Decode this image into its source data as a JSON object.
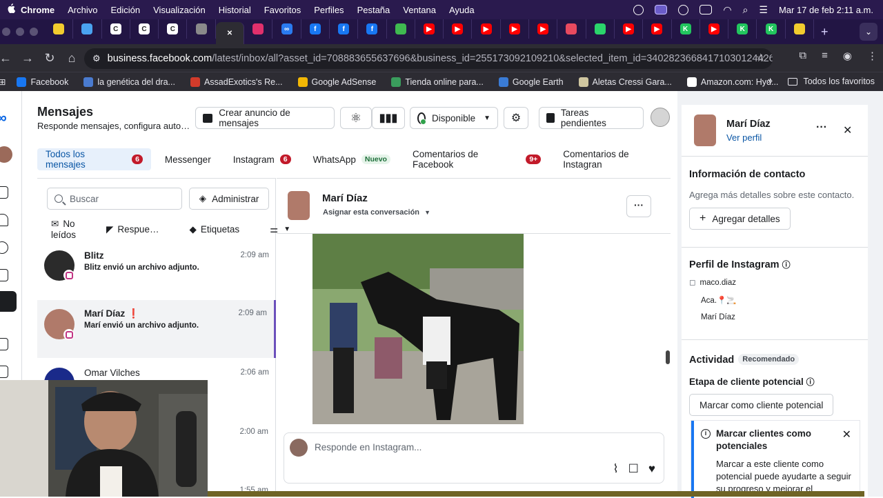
{
  "macos": {
    "menu": [
      "Chrome",
      "Archivo",
      "Edición",
      "Visualización",
      "Historial",
      "Favoritos",
      "Perfiles",
      "Pestaña",
      "Ventana",
      "Ayuda"
    ],
    "clock": "Mar 17 de feb  2:11 a.m."
  },
  "browser": {
    "url_host": "business.facebook.com",
    "url_path": "/latest/inbox/all?asset_id=708883655637696&business_id=255173092109210&selected_item_id=34028236684171030124426…",
    "tabs": [
      {
        "color": "#f2cc2e",
        "glyph": ""
      },
      {
        "color": "#4aa3f0",
        "glyph": ""
      },
      {
        "color": "#ffffff",
        "glyph": "C"
      },
      {
        "color": "#ffffff",
        "glyph": "C"
      },
      {
        "color": "#ffffff",
        "glyph": "C"
      },
      {
        "color": "#8a8a8a",
        "glyph": ""
      },
      {
        "color": "#ffffff",
        "glyph": "✕"
      },
      {
        "color": "#e1306c",
        "glyph": ""
      },
      {
        "color": "#2a7bf0",
        "glyph": "∞"
      },
      {
        "color": "#1877f2",
        "glyph": "f"
      },
      {
        "color": "#1877f2",
        "glyph": "f"
      },
      {
        "color": "#1877f2",
        "glyph": "f"
      },
      {
        "color": "#3fb950",
        "glyph": ""
      },
      {
        "color": "#ff0000",
        "glyph": "▶"
      },
      {
        "color": "#ff0000",
        "glyph": "▶"
      },
      {
        "color": "#ff0000",
        "glyph": "▶"
      },
      {
        "color": "#ff0000",
        "glyph": "▶"
      },
      {
        "color": "#ff0000",
        "glyph": "▶"
      },
      {
        "color": "#e84a5f",
        "glyph": ""
      },
      {
        "color": "#2bd46b",
        "glyph": ""
      },
      {
        "color": "#ff0000",
        "glyph": "▶"
      },
      {
        "color": "#ff0000",
        "glyph": "▶"
      },
      {
        "color": "#22c55e",
        "glyph": "K"
      },
      {
        "color": "#ff0000",
        "glyph": "▶"
      },
      {
        "color": "#22c55e",
        "glyph": "K"
      },
      {
        "color": "#22c55e",
        "glyph": "K"
      },
      {
        "color": "#f2cc2e",
        "glyph": ""
      }
    ],
    "bookmarks": [
      {
        "label": "Facebook",
        "color": "#1877f2"
      },
      {
        "label": "la genética del dra...",
        "color": "#4a7bd0"
      },
      {
        "label": "AssadExotics's Re...",
        "color": "#d23b2b"
      },
      {
        "label": "Google AdSense",
        "color": "#f2b705"
      },
      {
        "label": "Tienda online para...",
        "color": "#3a9d5d"
      },
      {
        "label": "Google Earth",
        "color": "#3a7bd5"
      },
      {
        "label": "Aletas Cressi Gara...",
        "color": "#cfc6a0"
      },
      {
        "label": "Amazon.com: Hyd...",
        "color": "#ffffff"
      }
    ],
    "all_bookmarks": "Todos los favoritos"
  },
  "inbox": {
    "title": "Mensajes",
    "subtitle": "Responde mensajes, configura auto…",
    "toolbar": {
      "create_ad": "Crear anuncio de mensajes",
      "status": "Disponible",
      "tasks": "Tareas pendientes"
    },
    "tabs": [
      {
        "label": "Todos los mensajes",
        "badge": "6"
      },
      {
        "label": "Messenger",
        "badge": ""
      },
      {
        "label": "Instagram",
        "badge": "6"
      },
      {
        "label": "WhatsApp",
        "badge": "Nuevo"
      },
      {
        "label": "Comentarios de Facebook",
        "badge": "9+"
      },
      {
        "label": "Comentarios de Instagran",
        "badge": ""
      }
    ],
    "search_placeholder": "Buscar",
    "manage_label": "Administrar",
    "filters": [
      "No leídos",
      "Respue…",
      "Etiquetas"
    ],
    "conversations": [
      {
        "name": "Blitz",
        "preview": "Blitz envió un archivo adjunto.",
        "time": "2:09 am"
      },
      {
        "name": "Marí Díaz",
        "flag": "❗",
        "preview": "Marí envió un archivo adjunto.",
        "time": "2:09 am"
      },
      {
        "name": "Omar Vilches",
        "preview": "",
        "time": "2:06 am"
      }
    ],
    "extra_times": [
      "2:00 am",
      "1:55 am"
    ],
    "chat": {
      "name": "Marí Díaz",
      "assign": "Asignar esta conversación",
      "compose_placeholder": "Responde en Instagram..."
    }
  },
  "contact": {
    "name": "Marí Díaz",
    "profile_link": "Ver perfil",
    "contact_info_title": "Información de contacto",
    "contact_info_text": "Agrega más detalles sobre este contacto.",
    "add_details": "Agregar detalles",
    "ig_title": "Perfil de Instagram",
    "ig_handle": "maco.diaz",
    "ig_bio": "Aca.📍🚬",
    "ig_name": "Marí Díaz",
    "activity_title": "Actividad",
    "recommended": "Recomendado",
    "lead_stage": "Etapa de cliente potencial",
    "mark_lead_btn": "Marcar como cliente potencial",
    "tip_title": "Marcar clientes como potenciales",
    "tip_text": "Marcar a este cliente como potencial puede ayudarte a seguir su progreso y mejorar el"
  }
}
